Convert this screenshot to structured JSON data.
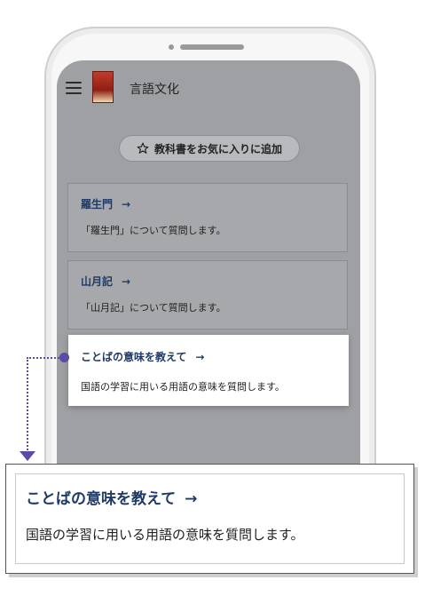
{
  "app": {
    "title": "言語文化"
  },
  "favorite_button": {
    "label": "教科書をお気に入りに追加"
  },
  "cards": [
    {
      "title": "羅生門",
      "description": "「羅生門」について質問します。"
    },
    {
      "title": "山月記",
      "description": "「山月記」について質問します。"
    }
  ],
  "highlight": {
    "title": "ことばの意味を教えて",
    "description": "国語の学習に用いる用語の意味を質問します。"
  },
  "arrow_glyph": "→",
  "colors": {
    "accent": "#1f3a66",
    "callout": "#5b4aa8",
    "overlay": "#9ea0a3"
  }
}
